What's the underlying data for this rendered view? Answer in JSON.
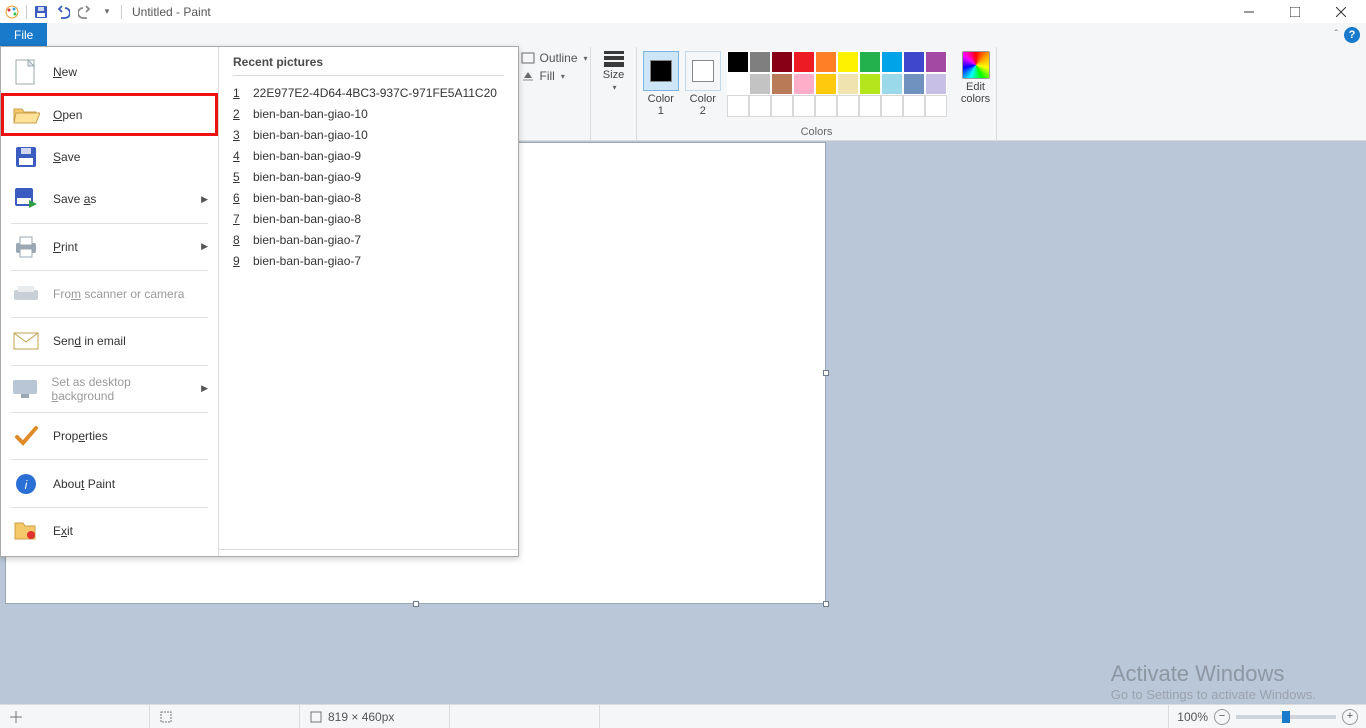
{
  "title": "Untitled - Paint",
  "file_tab": "File",
  "ribbon": {
    "outline": "Outline",
    "fill": "Fill",
    "size": "Size",
    "color1": "Color\n1",
    "color2": "Color\n2",
    "edit_colors": "Edit\ncolors",
    "colors_group": "Colors"
  },
  "palette_row1": [
    "#000000",
    "#7f7f7f",
    "#880015",
    "#ed1c24",
    "#ff7f27",
    "#fff200",
    "#22b14c",
    "#00a2e8",
    "#3f48cc",
    "#a349a4"
  ],
  "palette_row2": [
    "#ffffff",
    "#c3c3c3",
    "#b97a57",
    "#ffaec9",
    "#ffc90e",
    "#efe4b0",
    "#b5e61d",
    "#99d9ea",
    "#7092be",
    "#c8bfe7"
  ],
  "palette_row3": [
    "#ffffff",
    "#ffffff",
    "#ffffff",
    "#ffffff",
    "#ffffff",
    "#ffffff",
    "#ffffff",
    "#ffffff",
    "#ffffff",
    "#ffffff"
  ],
  "color1_value": "#000000",
  "color2_value": "#ffffff",
  "filemenu": {
    "new": "New",
    "open": "Open",
    "save": "Save",
    "save_as": "Save as",
    "print": "Print",
    "scanner": "From scanner or camera",
    "email": "Send in email",
    "desktop": "Set as desktop background",
    "properties": "Properties",
    "about": "About Paint",
    "exit": "Exit",
    "recent_header": "Recent pictures",
    "recent": [
      {
        "n": "1",
        "name": "22E977E2-4D64-4BC3-937C-971FE5A11C20"
      },
      {
        "n": "2",
        "name": "bien-ban-ban-giao-10"
      },
      {
        "n": "3",
        "name": "bien-ban-ban-giao-10"
      },
      {
        "n": "4",
        "name": "bien-ban-ban-giao-9"
      },
      {
        "n": "5",
        "name": "bien-ban-ban-giao-9"
      },
      {
        "n": "6",
        "name": "bien-ban-ban-giao-8"
      },
      {
        "n": "7",
        "name": "bien-ban-ban-giao-8"
      },
      {
        "n": "8",
        "name": "bien-ban-ban-giao-7"
      },
      {
        "n": "9",
        "name": "bien-ban-ban-giao-7"
      }
    ]
  },
  "watermark": {
    "title": "Activate Windows",
    "sub": "Go to Settings to activate Windows."
  },
  "status": {
    "dims": "819 × 460px",
    "zoom": "100%"
  }
}
